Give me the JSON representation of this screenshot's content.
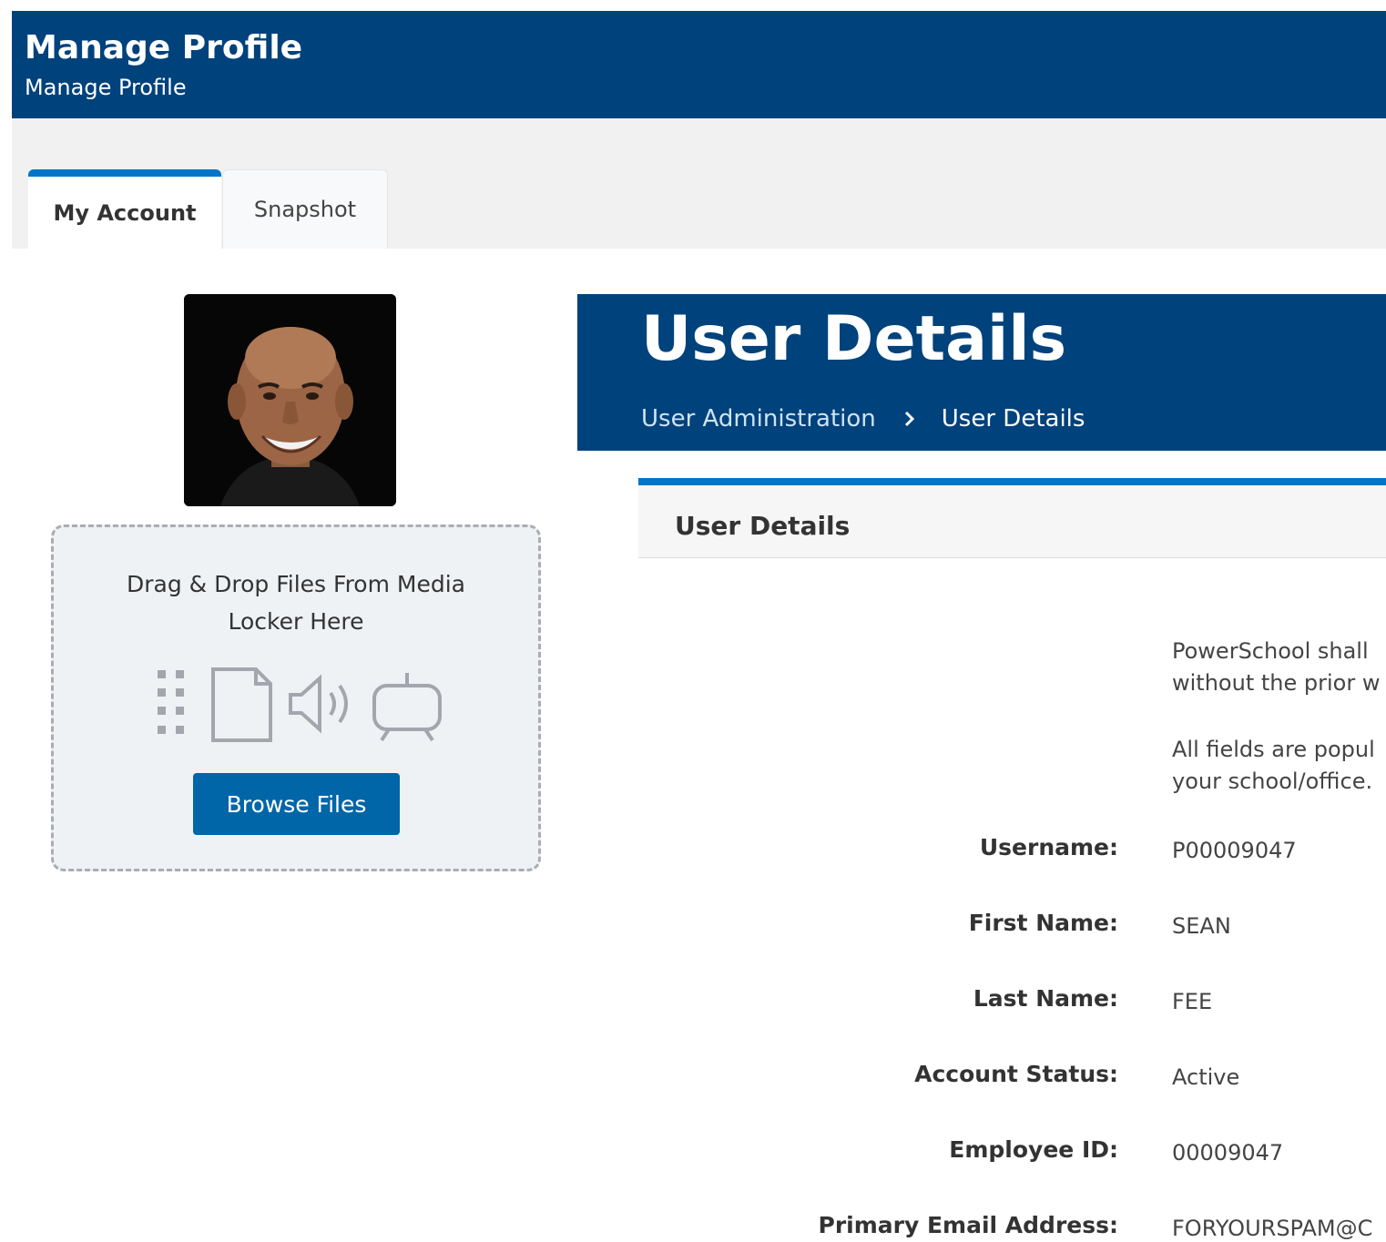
{
  "header": {
    "title": "Manage Profile",
    "subtitle": "Manage Profile"
  },
  "tabs": [
    {
      "label": "My Account",
      "active": true
    },
    {
      "label": "Snapshot",
      "active": false
    }
  ],
  "dropzone": {
    "text": "Drag & Drop Files From Media Locker Here",
    "icons": [
      "grid-icon",
      "document-icon",
      "audio-icon",
      "video-icon"
    ],
    "button_label": "Browse Files"
  },
  "page": {
    "title": "User Details",
    "breadcrumb": {
      "parent": "User Administration",
      "current": "User Details"
    }
  },
  "panel": {
    "title": "User Details",
    "intro_lines": [
      "PowerSchool shall",
      "without the prior w",
      "All fields are popul",
      "your school/office."
    ],
    "fields": [
      {
        "label": "Username:",
        "value": "P00009047"
      },
      {
        "label": "First Name:",
        "value": "SEAN"
      },
      {
        "label": "Last Name:",
        "value": "FEE"
      },
      {
        "label": "Account Status:",
        "value": "Active"
      },
      {
        "label": "Employee ID:",
        "value": "00009047"
      },
      {
        "label": "Primary Email Address:",
        "value": "FORYOURSPAM@C"
      }
    ]
  },
  "colors": {
    "header_bg": "#00427c",
    "accent": "#0075c9",
    "button_bg": "#0066a8"
  }
}
